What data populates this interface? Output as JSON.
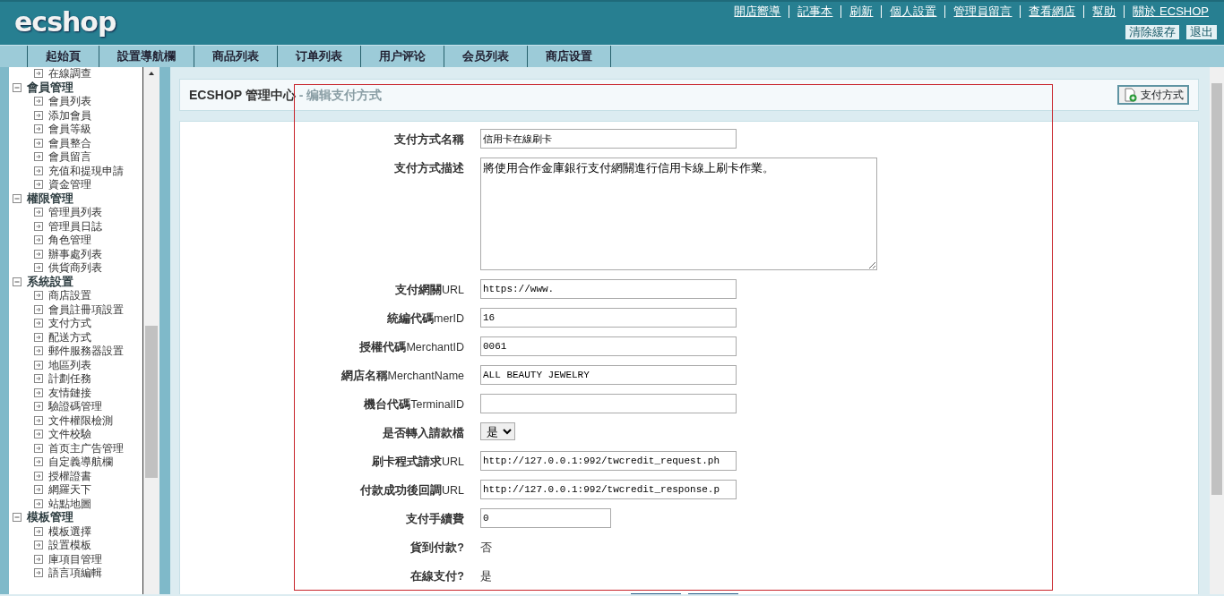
{
  "logo": {
    "text": "ecshop"
  },
  "top_links": [
    "開店嚮導",
    "記事本",
    "刷新",
    "個人設置",
    "管理員留言",
    "查看網店",
    "幫助",
    "關於 ECSHOP"
  ],
  "top_buttons": [
    "清除緩存",
    "退出"
  ],
  "nav_tabs": [
    {
      "label": "起始頁",
      "selected": false
    },
    {
      "label": "設置導航欄",
      "selected": false
    },
    {
      "label": "商品列表",
      "selected": false
    },
    {
      "label": "订单列表",
      "selected": false
    },
    {
      "label": "用户评论",
      "selected": false
    },
    {
      "label": "会员列表",
      "selected": false
    },
    {
      "label": "商店设置",
      "selected": false
    }
  ],
  "sidebar": [
    {
      "children": [
        {
          "label": "在線調查"
        }
      ]
    },
    {
      "label": "會員管理",
      "expanded": true,
      "children": [
        {
          "label": "會員列表"
        },
        {
          "label": "添加會員"
        },
        {
          "label": "會員等級"
        },
        {
          "label": "會員整合"
        },
        {
          "label": "會員留言"
        },
        {
          "label": "充值和提現申請"
        },
        {
          "label": "資金管理"
        }
      ]
    },
    {
      "label": "權限管理",
      "expanded": true,
      "children": [
        {
          "label": "管理員列表"
        },
        {
          "label": "管理員日誌"
        },
        {
          "label": "角色管理"
        },
        {
          "label": "辦事處列表"
        },
        {
          "label": "供貨商列表"
        }
      ]
    },
    {
      "label": "系統設置",
      "expanded": true,
      "children": [
        {
          "label": "商店設置"
        },
        {
          "label": "會員註冊項設置"
        },
        {
          "label": "支付方式"
        },
        {
          "label": "配送方式"
        },
        {
          "label": "郵件服務器設置"
        },
        {
          "label": "地區列表"
        },
        {
          "label": "計劃任務"
        },
        {
          "label": "友情鏈接"
        },
        {
          "label": "驗證碼管理"
        },
        {
          "label": "文件權限檢測"
        },
        {
          "label": "文件校驗"
        },
        {
          "label": "首页主广告管理"
        },
        {
          "label": "自定義導航欄"
        },
        {
          "label": "授權證書"
        },
        {
          "label": "網羅天下"
        },
        {
          "label": "站點地圖"
        }
      ]
    },
    {
      "label": "模板管理",
      "expanded": true,
      "children": [
        {
          "label": "模板選擇"
        },
        {
          "label": "設置模板"
        },
        {
          "label": "庫項目管理"
        },
        {
          "label": "語言項編輯"
        }
      ]
    }
  ],
  "page_title": {
    "app": "ECSHOP 管理中心",
    "section": " - 编辑支付方式"
  },
  "action_button": "支付方式",
  "form": [
    {
      "kind": "text",
      "label": "支付方式名稱",
      "value": "信用卡在線刷卡"
    },
    {
      "kind": "textarea",
      "label": "支付方式描述",
      "value": "將使用合作金庫銀行支付網關進行信用卡線上刷卡作業。"
    },
    {
      "kind": "text",
      "label": "**支付網關**URL",
      "value": "https://www."
    },
    {
      "kind": "text",
      "label": "**統編代碼**merID",
      "value": "16"
    },
    {
      "kind": "text",
      "label": "**授權代碼**MerchantID",
      "value": "0061"
    },
    {
      "kind": "text",
      "label": "**網店名稱**MerchantName",
      "value": "ALL BEAUTY JEWELRY"
    },
    {
      "kind": "text",
      "label": "**機台代碼**TerminalID"
    },
    {
      "kind": "select",
      "label": "是否轉入請款檔",
      "value": "是"
    },
    {
      "kind": "text",
      "label": "**刷卡程式請求**URL",
      "value": "http://127.0.0.1:992/twcredit_request.ph"
    },
    {
      "kind": "text",
      "label": "**付款成功後回調**URL",
      "value": "http://127.0.0.1:992/twcredit_response.p"
    },
    {
      "kind": "short",
      "label": "支付手續費",
      "value": "0"
    },
    {
      "kind": "static",
      "label": "貨到付款?",
      "value": "否"
    },
    {
      "kind": "static",
      "label": "在線支付?",
      "value": "是"
    }
  ],
  "annotation_frame": true
}
